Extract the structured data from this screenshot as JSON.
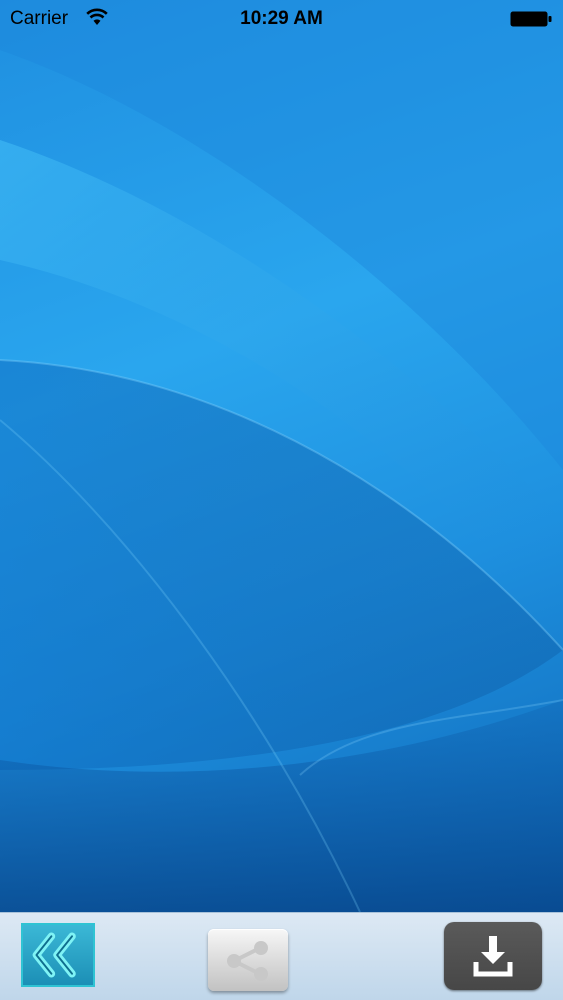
{
  "status_bar": {
    "carrier": "Carrier",
    "time": "10:29 AM",
    "wifi_icon": "wifi-icon",
    "battery_icon": "battery-icon"
  },
  "wallpaper": {
    "description_icon": "abstract-blue-wave-wallpaper",
    "colors": [
      "#1f8fe0",
      "#2aa6ee",
      "#0b5fae"
    ]
  },
  "toolbar": {
    "back_icon": "double-chevron-left-icon",
    "share_icon": "share-icon",
    "download_icon": "download-icon",
    "colors": {
      "back": "#2fc3d3",
      "share": "#d9d9d9",
      "download": "#4f4f4f"
    }
  }
}
